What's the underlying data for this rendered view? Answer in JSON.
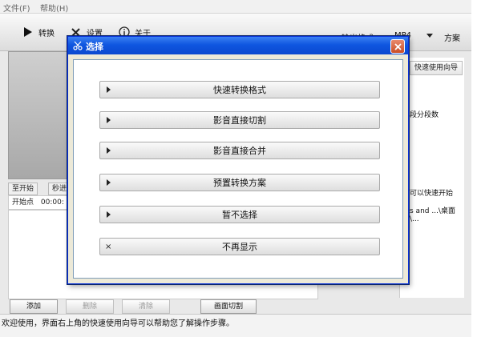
{
  "menubar": {
    "file": "文件(F)",
    "help": "帮助(H)"
  },
  "toolbar": {
    "convert": "转换",
    "settings": "设置",
    "about": "关于",
    "output_format_label": "输出格式",
    "output_format_value": "MP4",
    "scheme": "方案"
  },
  "left": {
    "to_start": "至开始",
    "seconds": "秒进",
    "start_point_label": "开始点",
    "start_point_value": "00:00:"
  },
  "right": {
    "wizard_tab": "快速使用向导",
    "segments": "段分段数",
    "quick_start": "可以快速开始",
    "path": "s and ...\\桌面\\..."
  },
  "bottom": {
    "add": "添加",
    "delete": "删除",
    "clear": "清除",
    "screen_cut": "画面切割"
  },
  "status": {
    "text": "欢迎使用，界面右上角的快速使用向导可以帮助您了解操作步骤。"
  },
  "dialog": {
    "title": "选择",
    "options": [
      "快速转换格式",
      "影音直接切割",
      "影音直接合并",
      "预置转换方案",
      "暂不选择"
    ],
    "no_show": "不再显示"
  },
  "icons": {
    "convert": "play-icon",
    "settings": "tools-icon",
    "about": "info-icon",
    "dialog": "scissors-icon",
    "close": "close-icon"
  },
  "colors": {
    "title_bar": "#0f56e0",
    "close": "#d45a33",
    "dialog_bg": "#ece9d8"
  }
}
